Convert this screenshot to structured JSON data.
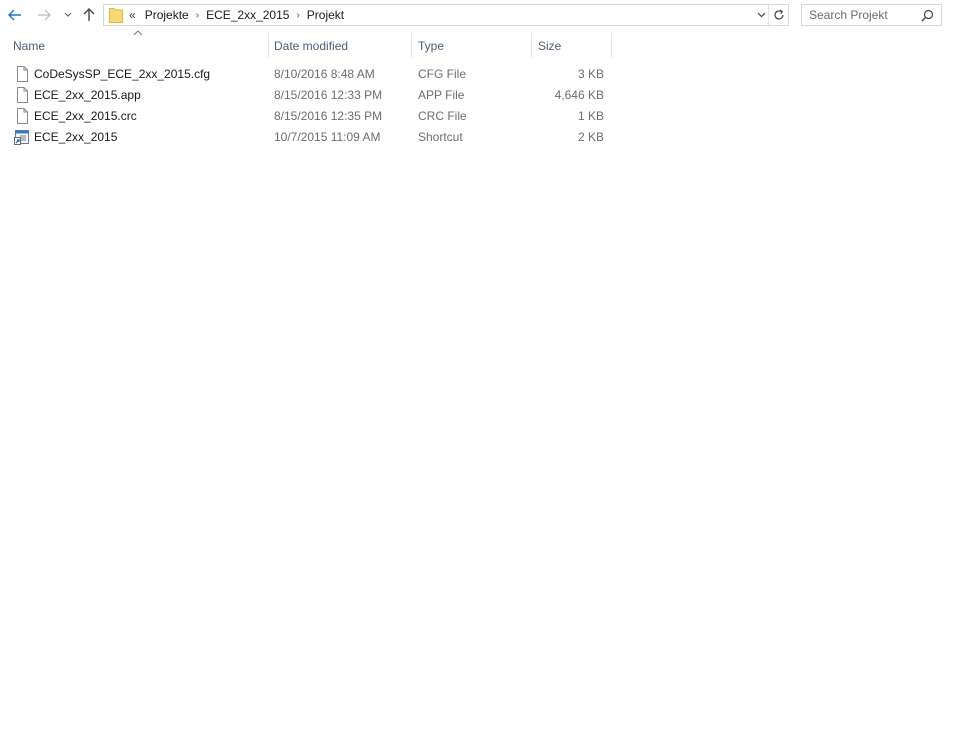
{
  "addressbar": {
    "overflow": "«",
    "breadcrumbs": [
      "Projekte",
      "ECE_2xx_2015",
      "Projekt"
    ],
    "separator": "›"
  },
  "search": {
    "placeholder": "Search Projekt"
  },
  "columns": {
    "name": "Name",
    "date": "Date modified",
    "type": "Type",
    "size": "Size"
  },
  "files": [
    {
      "name": "CoDeSysSP_ECE_2xx_2015.cfg",
      "date": "8/10/2016 8:48 AM",
      "type": "CFG File",
      "size": "3 KB",
      "icon": "file-icon"
    },
    {
      "name": "ECE_2xx_2015.app",
      "date": "8/15/2016 12:33 PM",
      "type": "APP File",
      "size": "4,646 KB",
      "icon": "file-icon"
    },
    {
      "name": "ECE_2xx_2015.crc",
      "date": "8/15/2016 12:35 PM",
      "type": "CRC File",
      "size": "1 KB",
      "icon": "file-icon"
    },
    {
      "name": "ECE_2xx_2015",
      "date": "10/7/2015 11:09 AM",
      "type": "Shortcut",
      "size": "2 KB",
      "icon": "shortcut-icon"
    }
  ],
  "colors": {
    "back_arrow": "#1979ca",
    "header_text": "#4c607a",
    "secondary_text": "#6d6d6d",
    "folder": "#f8d775"
  }
}
